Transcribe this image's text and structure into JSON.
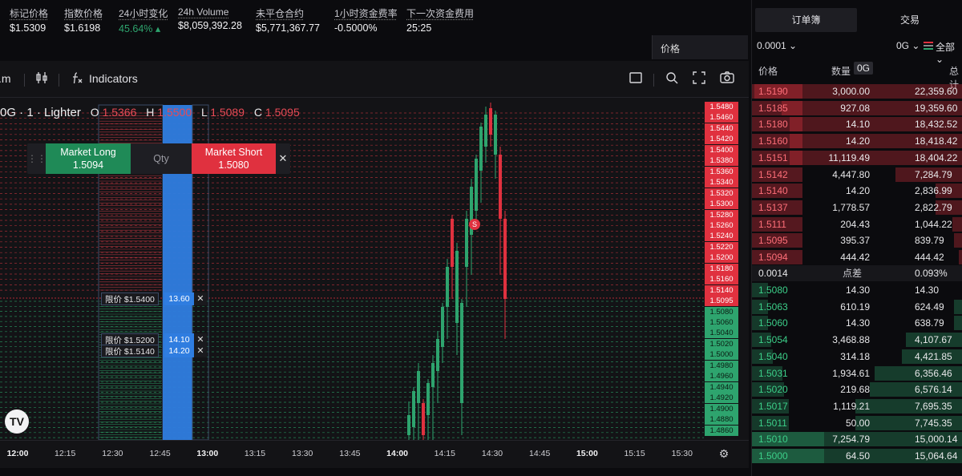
{
  "stats": [
    {
      "label": "标记价格",
      "value": "$1.5309"
    },
    {
      "label": "指数价格",
      "value": "$1.6198"
    },
    {
      "label": "24小时变化",
      "value": "45.64% ▴"
    },
    {
      "label": "24h Volume",
      "value": "$8,059,392.28"
    },
    {
      "label": "未平仓合约",
      "value": "$5,771,367.77"
    },
    {
      "label": "1小时资金费率",
      "value": "-0.5000%"
    },
    {
      "label": "下一次资金费用",
      "value": "25:25"
    }
  ],
  "price_select": "价格",
  "toolbar": {
    "interval": ".m",
    "indicators": "Indicators"
  },
  "legend": {
    "symbol": "0G · 1 · Lighter",
    "o_key": "O",
    "o": "1.5366",
    "h_key": "H",
    "h": "1.5500",
    "l_key": "L",
    "l": "1.5089",
    "c_key": "C",
    "c": "1.5095"
  },
  "trade_panel": {
    "long_label": "Market Long",
    "long_price": "1.5094",
    "qty": "Qty",
    "short_label": "Market Short",
    "short_price": "1.5080"
  },
  "orders": [
    {
      "text": "限价 $1.5400",
      "qty": "13.60"
    },
    {
      "text": "限价 $1.5200",
      "qty": "14.10"
    },
    {
      "text": "限价 $1.5140",
      "qty": "14.20"
    }
  ],
  "s_marker": "S",
  "price_axis": [
    "1.5480",
    "1.5460",
    "1.5440",
    "1.5420",
    "1.5400",
    "1.5380",
    "1.5360",
    "1.5340",
    "1.5320",
    "1.5300",
    "1.5280",
    "1.5260",
    "1.5240",
    "1.5220",
    "1.5200",
    "1.5180",
    "1.5160",
    "1.5140",
    "1.5095",
    "1.5080",
    "1.5060",
    "1.5040",
    "1.5020",
    "1.5000",
    "1.4980",
    "1.4960",
    "1.4940",
    "1.4920",
    "1.4900",
    "1.4880",
    "1.4860"
  ],
  "time_axis": [
    "12:00",
    "12:15",
    "12:30",
    "12:45",
    "13:00",
    "13:15",
    "13:30",
    "13:45",
    "14:00",
    "14:15",
    "14:30",
    "14:45",
    "15:00",
    "15:15",
    "15:30"
  ],
  "colors": {
    "up": "#2ea46e",
    "down": "#e0313f",
    "accent": "#2f7de0"
  },
  "orderbook": {
    "tabs": [
      "订单簿",
      "交易"
    ],
    "tick": "0.0001",
    "symbol": "0G",
    "filter": "全部",
    "col_price": "价格",
    "col_size": "数量",
    "col_size_unit": "0G",
    "col_total": "总计",
    "asks": [
      {
        "price": "1.5190",
        "size": "3,000.00",
        "total": "22,359.60",
        "depth": 0.99
      },
      {
        "price": "1.5185",
        "size": "927.08",
        "total": "19,359.60",
        "depth": 0.86
      },
      {
        "price": "1.5180",
        "size": "14.10",
        "total": "18,432.52",
        "depth": 0.82
      },
      {
        "price": "1.5160",
        "size": "14.20",
        "total": "18,418.42",
        "depth": 0.82
      },
      {
        "price": "1.5151",
        "size": "11,119.49",
        "total": "18,404.22",
        "depth": 0.82
      },
      {
        "price": "1.5142",
        "size": "4,447.80",
        "total": "7,284.79",
        "depth": 0.32
      },
      {
        "price": "1.5140",
        "size": "14.20",
        "total": "2,836.99",
        "depth": 0.13
      },
      {
        "price": "1.5137",
        "size": "1,778.57",
        "total": "2,822.79",
        "depth": 0.13
      },
      {
        "price": "1.5111",
        "size": "204.43",
        "total": "1,044.22",
        "depth": 0.05
      },
      {
        "price": "1.5095",
        "size": "395.37",
        "total": "839.79",
        "depth": 0.04
      },
      {
        "price": "1.5094",
        "size": "444.42",
        "total": "444.42",
        "depth": 0.02
      }
    ],
    "spread": {
      "value": "0.0014",
      "label": "点差",
      "pct": "0.093%"
    },
    "bids": [
      {
        "price": "1.5080",
        "size": "14.30",
        "total": "14.30",
        "depth": 0.0
      },
      {
        "price": "1.5063",
        "size": "610.19",
        "total": "624.49",
        "depth": 0.04
      },
      {
        "price": "1.5060",
        "size": "14.30",
        "total": "638.79",
        "depth": 0.04
      },
      {
        "price": "1.5054",
        "size": "3,468.88",
        "total": "4,107.67",
        "depth": 0.27
      },
      {
        "price": "1.5040",
        "size": "314.18",
        "total": "4,421.85",
        "depth": 0.29
      },
      {
        "price": "1.5031",
        "size": "1,934.61",
        "total": "6,356.46",
        "depth": 0.42
      },
      {
        "price": "1.5020",
        "size": "219.68",
        "total": "6,576.14",
        "depth": 0.44
      },
      {
        "price": "1.5017",
        "size": "1,119.21",
        "total": "7,695.35",
        "depth": 0.51
      },
      {
        "price": "1.5011",
        "size": "50.00",
        "total": "7,745.35",
        "depth": 0.51
      },
      {
        "price": "1.5010",
        "size": "7,254.79",
        "total": "15,000.14",
        "depth": 1.0
      },
      {
        "price": "1.5000",
        "size": "64.50",
        "total": "15,064.64",
        "depth": 1.0
      }
    ]
  }
}
